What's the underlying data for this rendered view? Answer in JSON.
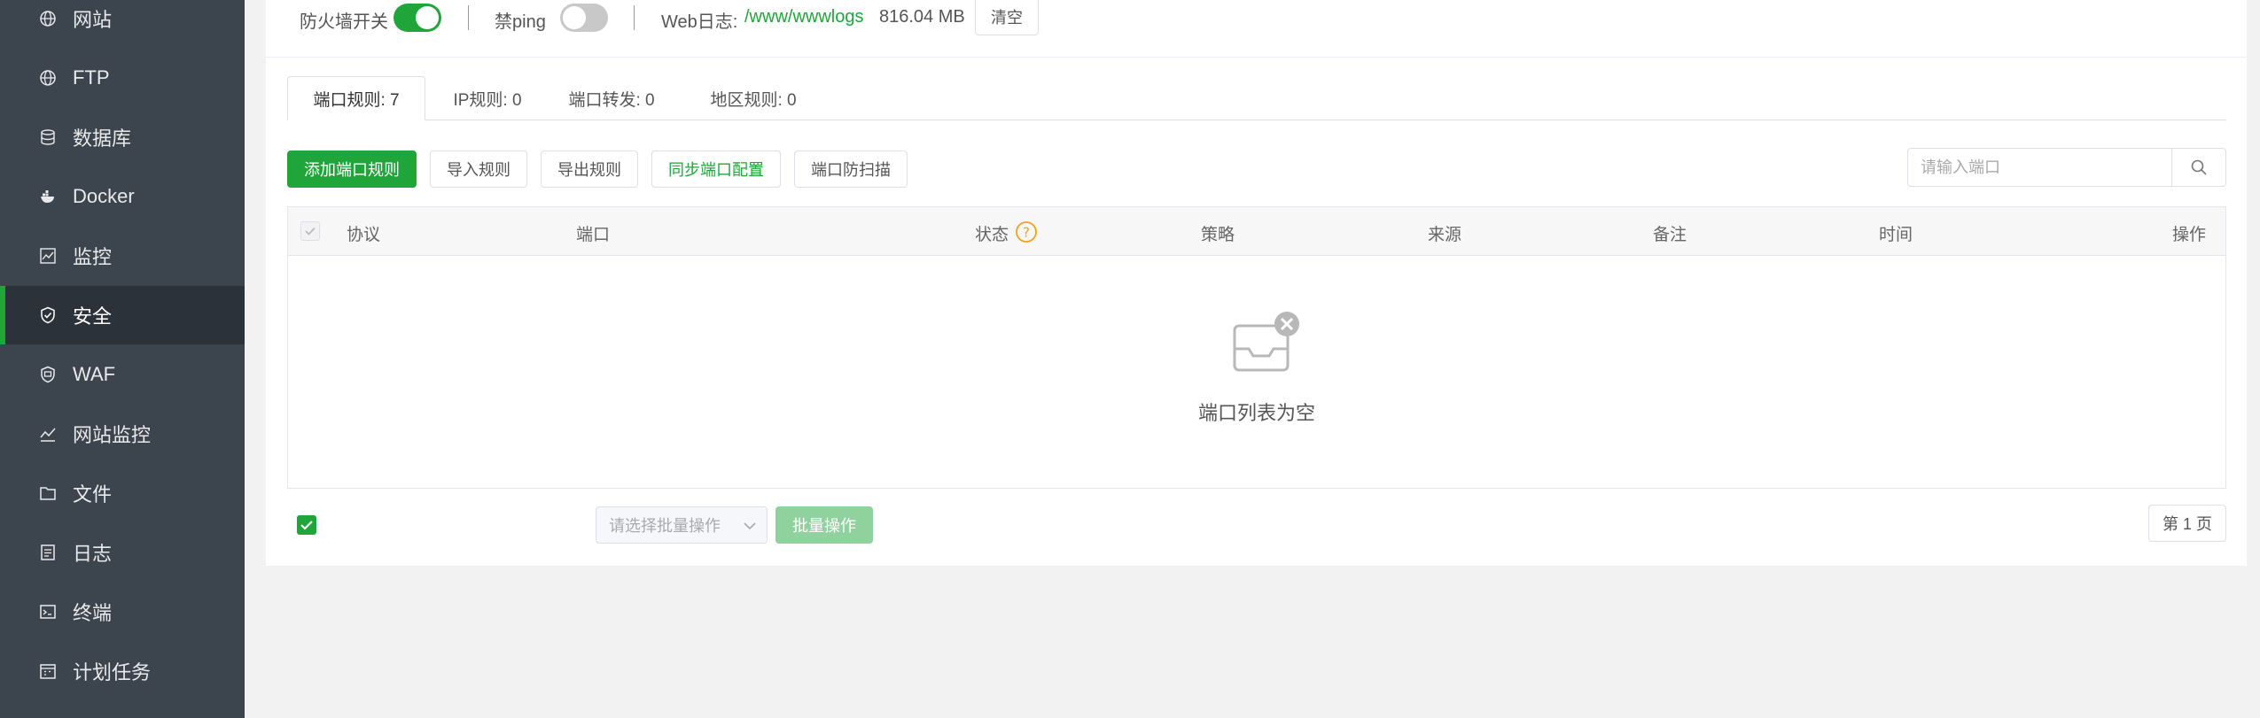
{
  "sidebar": {
    "items": [
      {
        "label": "网站",
        "icon": "globe-icon"
      },
      {
        "label": "FTP",
        "icon": "globe-icon"
      },
      {
        "label": "数据库",
        "icon": "database-icon"
      },
      {
        "label": "Docker",
        "icon": "docker-icon"
      },
      {
        "label": "监控",
        "icon": "monitor-icon"
      },
      {
        "label": "安全",
        "icon": "shield-check-icon",
        "active": true
      },
      {
        "label": "WAF",
        "icon": "waf-shield-icon"
      },
      {
        "label": "网站监控",
        "icon": "chart-line-icon"
      },
      {
        "label": "文件",
        "icon": "folder-icon"
      },
      {
        "label": "日志",
        "icon": "log-icon"
      },
      {
        "label": "终端",
        "icon": "terminal-icon"
      },
      {
        "label": "计划任务",
        "icon": "calendar-icon"
      }
    ]
  },
  "top": {
    "firewall_label": "防火墙开关",
    "firewall_on": true,
    "ping_label": "禁ping",
    "ping_on": false,
    "weblog_label": "Web日志:",
    "weblog_path": "/www/wwwlogs",
    "weblog_size": "816.04 MB",
    "clear_label": "清空"
  },
  "tabs": [
    {
      "label": "端口规则: 7",
      "active": true
    },
    {
      "label": "IP规则: 0"
    },
    {
      "label": "端口转发: 0"
    },
    {
      "label": "地区规则: 0"
    }
  ],
  "toolbar": {
    "add": "添加端口规则",
    "import": "导入规则",
    "export": "导出规则",
    "sync": "同步端口配置",
    "scan": "端口防扫描",
    "search_placeholder": "请输入端口"
  },
  "table": {
    "columns": [
      "协议",
      "端口",
      "状态",
      "策略",
      "来源",
      "备注",
      "时间",
      "操作"
    ],
    "empty": "端口列表为空"
  },
  "bottom": {
    "batch_placeholder": "请选择批量操作",
    "batch_button": "批量操作",
    "page": "第 1 页"
  },
  "colors": {
    "accent": "#20a53a",
    "sidebar": "#3c444d",
    "warning": "#f0a020"
  }
}
